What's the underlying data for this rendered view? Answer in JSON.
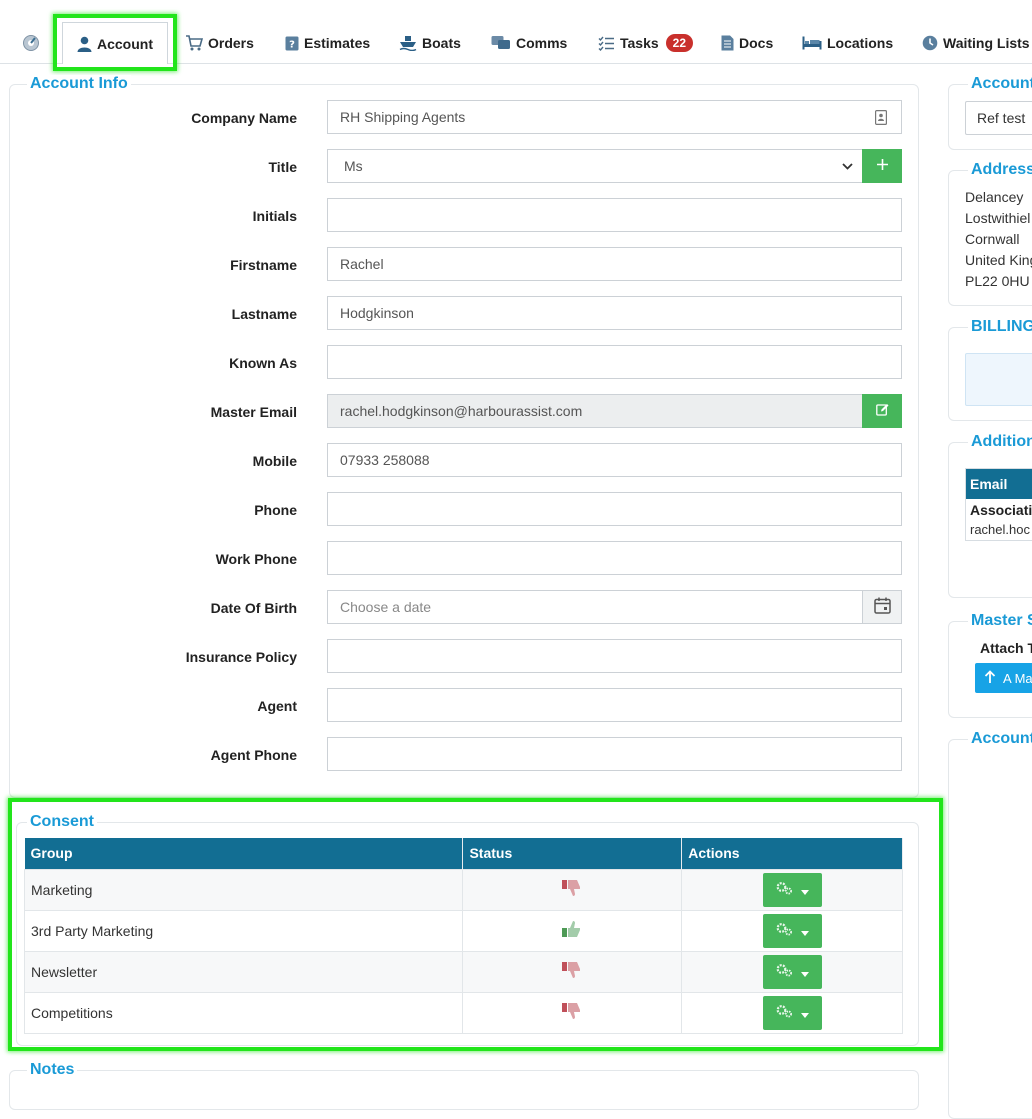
{
  "tabs": [
    {
      "label": "",
      "icon": "dashboard-icon"
    },
    {
      "label": "Account",
      "icon": "user-icon",
      "active": true
    },
    {
      "label": "Orders",
      "icon": "cart-icon"
    },
    {
      "label": "Estimates",
      "icon": "question-box-icon"
    },
    {
      "label": "Boats",
      "icon": "boat-icon"
    },
    {
      "label": "Comms",
      "icon": "chat-icon"
    },
    {
      "label": "Tasks",
      "icon": "checklist-icon",
      "badge": "22"
    },
    {
      "label": "Docs",
      "icon": "document-icon"
    },
    {
      "label": "Locations",
      "icon": "bed-icon"
    },
    {
      "label": "Waiting Lists",
      "icon": "clock-icon"
    }
  ],
  "account_info": {
    "title": "Account Info",
    "fields": {
      "company_name": {
        "label": "Company Name",
        "value": "RH Shipping Agents"
      },
      "title": {
        "label": "Title",
        "value": "Ms"
      },
      "initials": {
        "label": "Initials",
        "value": ""
      },
      "firstname": {
        "label": "Firstname",
        "value": "Rachel"
      },
      "lastname": {
        "label": "Lastname",
        "value": "Hodgkinson"
      },
      "known_as": {
        "label": "Known As",
        "value": ""
      },
      "master_email": {
        "label": "Master Email",
        "value": "rachel.hodgkinson@harbourassist.com"
      },
      "mobile": {
        "label": "Mobile",
        "value": "07933 258088"
      },
      "phone": {
        "label": "Phone",
        "value": ""
      },
      "work_phone": {
        "label": "Work Phone",
        "value": ""
      },
      "date_of_birth": {
        "label": "Date Of Birth",
        "value": "",
        "placeholder": "Choose a date"
      },
      "insurance_policy": {
        "label": "Insurance Policy",
        "value": ""
      },
      "agent": {
        "label": "Agent",
        "value": ""
      },
      "agent_phone": {
        "label": "Agent Phone",
        "value": ""
      }
    }
  },
  "consent": {
    "title": "Consent",
    "columns": [
      "Group",
      "Status",
      "Actions"
    ],
    "rows": [
      {
        "group": "Marketing",
        "status": "thumbs-down"
      },
      {
        "group": "3rd Party Marketing",
        "status": "thumbs-up"
      },
      {
        "group": "Newsletter",
        "status": "thumbs-down"
      },
      {
        "group": "Competitions",
        "status": "thumbs-down"
      }
    ]
  },
  "notes": {
    "title": "Notes"
  },
  "right": {
    "account_title": "Account",
    "account_ref": "Ref test",
    "address_title": "Address",
    "address_lines": [
      "Delancey",
      "Lostwithiel",
      "Cornwall",
      "United King",
      "PL22 0HU"
    ],
    "billing_title": "BILLING",
    "additional_title": "Addition",
    "email_header": "Email",
    "association_label": "Associatio",
    "association_email": "rachel.hoc",
    "master_title": "Master S",
    "attach_label": "Attach T",
    "attach_button": "A Ma",
    "account2_title": "Account"
  },
  "colors": {
    "accent": "#1a9ad6",
    "table_header": "#126e93",
    "green": "#46b65b",
    "badge": "#c9302c",
    "thumb_down": "#c0505a",
    "thumb_up": "#4e9a56"
  }
}
